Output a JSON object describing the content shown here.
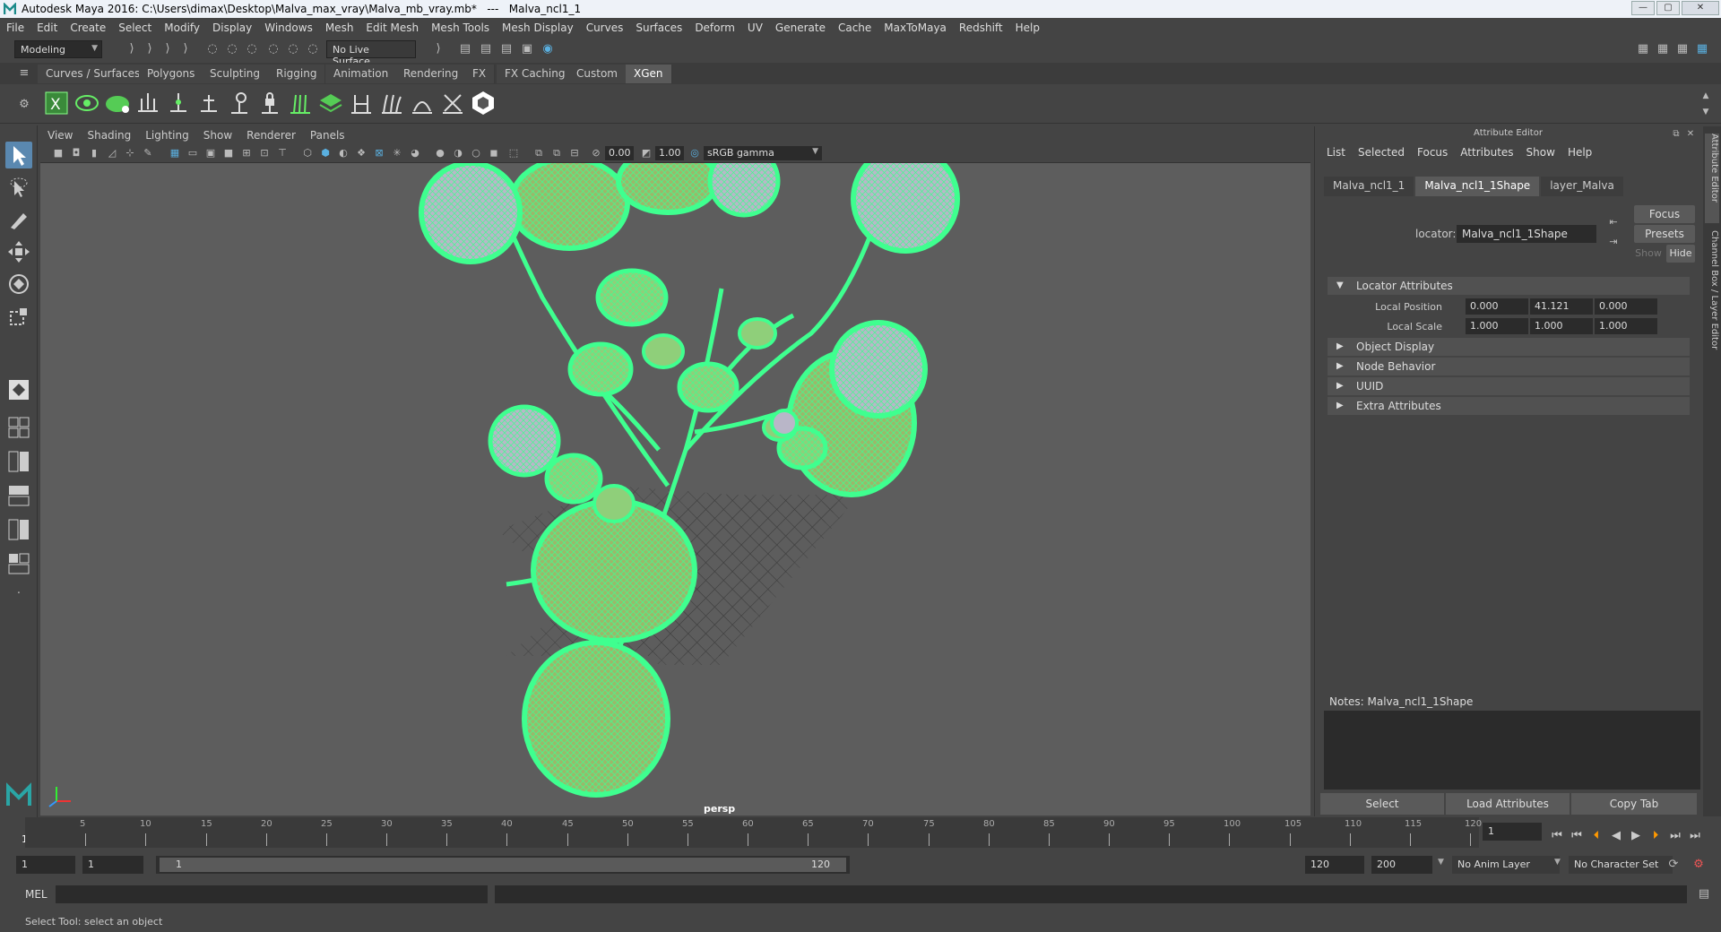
{
  "window": {
    "title": "Autodesk Maya 2016: C:\\Users\\dimax\\Desktop\\Malva_max_vray\\Malva_mb_vray.mb*   ---   Malva_ncl1_1",
    "min_label": "—",
    "max_label": "▢",
    "close_label": "✕"
  },
  "menu": [
    "File",
    "Edit",
    "Create",
    "Select",
    "Modify",
    "Display",
    "Windows",
    "Mesh",
    "Edit Mesh",
    "Mesh Tools",
    "Mesh Display",
    "Curves",
    "Surfaces",
    "Deform",
    "UV",
    "Generate",
    "Cache",
    "MaxToMaya",
    "Redshift",
    "Help"
  ],
  "statusline": {
    "mode": "Modeling",
    "live_surface": "No Live Surface"
  },
  "shelf_tabs": [
    "Curves / Surfaces",
    "Polygons",
    "Sculpting",
    "Rigging",
    "Animation",
    "Rendering",
    "FX",
    "FX Caching",
    "Custom",
    "XGen"
  ],
  "active_shelf_tab": "XGen",
  "viewport": {
    "menu": [
      "View",
      "Shading",
      "Lighting",
      "Show",
      "Renderer",
      "Panels"
    ],
    "exposure": "0.00",
    "gamma": "1.00",
    "color_space": "sRGB gamma",
    "camera": "persp"
  },
  "attribute_editor": {
    "title": "Attribute Editor",
    "menu": [
      "List",
      "Selected",
      "Focus",
      "Attributes",
      "Show",
      "Help"
    ],
    "tabs": [
      "Malva_ncl1_1",
      "Malva_ncl1_1Shape",
      "layer_Malva"
    ],
    "active_tab": "Malva_ncl1_1Shape",
    "node_type_label": "locator:",
    "node_name": "Malva_ncl1_1Shape",
    "focus_label": "Focus",
    "presets_label": "Presets",
    "show_label": "Show",
    "hide_label": "Hide",
    "sections": {
      "locator": "Locator Attributes",
      "object_display": "Object Display",
      "node_behavior": "Node Behavior",
      "uuid": "UUID",
      "extra": "Extra Attributes"
    },
    "local_position": {
      "label": "Local Position",
      "x": "0.000",
      "y": "41.121",
      "z": "0.000"
    },
    "local_scale": {
      "label": "Local Scale",
      "x": "1.000",
      "y": "1.000",
      "z": "1.000"
    },
    "notes_label": "Notes:  Malva_ncl1_1Shape",
    "buttons": {
      "select": "Select",
      "load": "Load Attributes",
      "copy": "Copy Tab"
    }
  },
  "side_tabs": [
    "Attribute Editor",
    "Channel Box / Layer Editor"
  ],
  "timeline": {
    "ticks": [
      5,
      10,
      15,
      20,
      25,
      30,
      35,
      40,
      45,
      50,
      55,
      60,
      65,
      70,
      75,
      80,
      85,
      90,
      95,
      100,
      105,
      110,
      115,
      120
    ],
    "start_label": "1",
    "current_frame": "1"
  },
  "range": {
    "start": "1",
    "playback_start": "1",
    "slider_start": "1",
    "slider_end": "120",
    "playback_end": "120",
    "end": "200",
    "anim_layer": "No Anim Layer",
    "character_set": "No Character Set"
  },
  "cmdline": {
    "label": "MEL"
  },
  "helpline": "Select Tool: select an object",
  "colors": {
    "wire": "#3fff8f",
    "accent": "#5a88b0"
  }
}
